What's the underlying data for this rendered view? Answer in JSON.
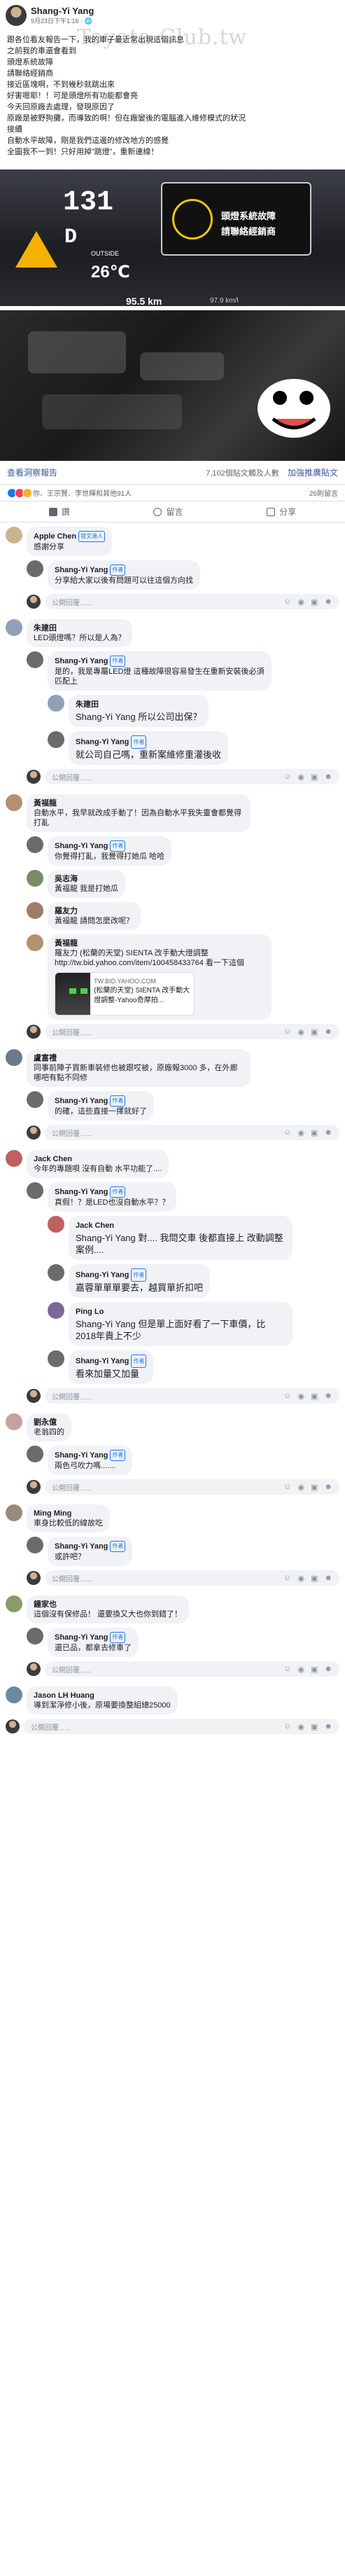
{
  "watermark": "Toyota-Club.tw",
  "post": {
    "author": "Shang-Yi Yang",
    "date": "9月23日下午1:16 · 🌐",
    "lines": [
      "跟各位看友報告一下，我的車子最近常出現這個訊息",
      "之前我的車還會看到",
      "頭燈系統故障",
      "請聯絡經銷商",
      "接近區塊啊，不到幾秒就跳出來",
      "好害嗯耶！！可是頭燈所有功能都會亮",
      "今天回原廠去處理，發現原因了",
      "原廠是被野狗攤，而導致的啊！但在廠變後的電腦進入維修模式的狀況",
      "接續",
      "自動水平故障，剛是我們這邊的修改地方的感覺",
      "全圖我不一到！只好用掉”跳燈”，重新連線！"
    ]
  },
  "photo1": {
    "odometer_top": "131",
    "gear": "D",
    "warning_line1": "頭燈系統故障",
    "warning_line2": "請聯絡經銷商",
    "outside_label": "OUTSIDE",
    "temperature": "26℃",
    "odometer": "95.5 km",
    "mileage_label": "97.9 km/l"
  },
  "stats": {
    "insights_link": "查看洞察報告",
    "reach": "7,102個貼文觸及人數",
    "boost": "加強推廣貼文"
  },
  "reactions": {
    "names": "你、王宗賢、李世輝和其他91人",
    "comment_count": "26則留言"
  },
  "actions": {
    "like": "讚",
    "comment": "留言",
    "share": "分享"
  },
  "compose_placeholder": "公開回覆......",
  "comments": [
    {
      "name": "Apple Chen",
      "badge": "發文達人",
      "text": "感謝分享",
      "level": 0,
      "av": "#c9b58f"
    },
    {
      "name": "Shang-Yi Yang",
      "badge": "作者",
      "text": "分享給大家以後有問題可以往這個方向找",
      "level": 1,
      "av": "#6b6b6b"
    },
    {
      "name": "朱建田",
      "badge": "",
      "text": "LED頭燈嗎？所以是人為？",
      "level": 0,
      "av": "#8fa0b8"
    },
    {
      "name": "Shang-Yi Yang",
      "badge": "作者",
      "text": "是的，我是專屬LED燈 這種故障很容易發生在重新安裝後必須匹配上",
      "level": 1,
      "av": "#6b6b6b"
    },
    {
      "name": "朱建田",
      "badge": "",
      "text": "Shang-Yi Yang 所以公司出保？",
      "level": 2,
      "av": "#8fa0b8"
    },
    {
      "name": "Shang-Yi Yang",
      "badge": "作者",
      "text": "就公司自己嗎，重新案維修重灌後收",
      "level": 2,
      "av": "#6b6b6b"
    },
    {
      "name": "黃福龍",
      "badge": "",
      "text": "自動水平，我早就改成手動了！因為自動水平我失靈會都覺得打亂",
      "level": 0,
      "av": "#b29070"
    },
    {
      "name": "Shang-Yi Yang",
      "badge": "作者",
      "text": "你覺得打亂，我覺得打她瓜 哈哈",
      "level": 1,
      "av": "#6b6b6b"
    },
    {
      "name": "吳志海",
      "badge": "",
      "text": "黃福龍 我是打她瓜",
      "level": 1,
      "av": "#7a8a6a"
    },
    {
      "name": "羅友力",
      "badge": "",
      "text": "黃福龍 請問怎麼改呢？",
      "level": 1,
      "av": "#a07a6a"
    },
    {
      "name": "黃福龍",
      "badge": "",
      "text": "羅友力 (松蘭的天堂) SIENTA 改手動大燈調整 http://tw.bid.yahoo.com/item/100458433764 看一下這個",
      "level": 1,
      "av": "#b29070",
      "card_domain": "TW.BID.YAHOO.COM",
      "card_title": "(松蘭的天堂) SIENTA 改手動大燈調整-Yahoo奇摩拍..."
    },
    {
      "name": "盧富禮",
      "badge": "",
      "text": "同事前陣子買新車裝修也被跟哎被，原廠報3000 多，在外廊哪吧有點不同修",
      "level": 0,
      "av": "#6a7a8a"
    },
    {
      "name": "Shang-Yi Yang",
      "badge": "作者",
      "text": "的確，這些直接一擇就好了",
      "level": 1,
      "av": "#6b6b6b"
    },
    {
      "name": "Jack Chen",
      "badge": "",
      "text": "今年的專題唄 沒有自動 水平功能了....",
      "level": 0,
      "av": "#c06060"
    },
    {
      "name": "Shang-Yi Yang",
      "badge": "作者",
      "text": "真假！？是LED也沒自動水平？？",
      "level": 1,
      "av": "#6b6b6b"
    },
    {
      "name": "Jack Chen",
      "badge": "",
      "text": "Shang-Yi Yang 對.... 我問交車 後都直接上 改動調整案例....",
      "level": 2,
      "av": "#c06060"
    },
    {
      "name": "Shang-Yi Yang",
      "badge": "作者",
      "text": "嘉蓉單單單要去，越買單折扣吧",
      "level": 2,
      "av": "#6b6b6b"
    },
    {
      "name": "Ping Lo",
      "badge": "",
      "text": "Shang-Yi Yang 但是單上面好看了一下車價，比2018年貴上不少",
      "level": 2,
      "av": "#7a6a9a"
    },
    {
      "name": "Shang-Yi Yang",
      "badge": "作者",
      "text": "看來加量又加量",
      "level": 2,
      "av": "#6b6b6b"
    },
    {
      "name": "劉永億",
      "badge": "",
      "text": "老翁四的",
      "level": 0,
      "av": "#c8a0a0"
    },
    {
      "name": "Shang-Yi Yang",
      "badge": "作者",
      "text": "兩色弓吹力嗎.......",
      "level": 1,
      "av": "#6b6b6b"
    },
    {
      "name": "Ming Ming",
      "badge": "",
      "text": "車身比較低的線故吃",
      "level": 0,
      "av": "#9a8a7a"
    },
    {
      "name": "Shang-Yi Yang",
      "badge": "作者",
      "text": "或許吧？",
      "level": 1,
      "av": "#6b6b6b"
    },
    {
      "name": "鍾家也",
      "badge": "",
      "text": "這個沒有保修品！ 還要換又大也你到錯了！",
      "level": 0,
      "av": "#8a9a6a"
    },
    {
      "name": "Shang-Yi Yang",
      "badge": "作者",
      "text": "還已品，都拿去修車了",
      "level": 1,
      "av": "#6b6b6b"
    },
    {
      "name": "Jason LH Huang",
      "badge": "",
      "text": "導到潔淨修小後，原場要換整組總25000",
      "level": 0,
      "av": "#6a8aa0"
    }
  ]
}
